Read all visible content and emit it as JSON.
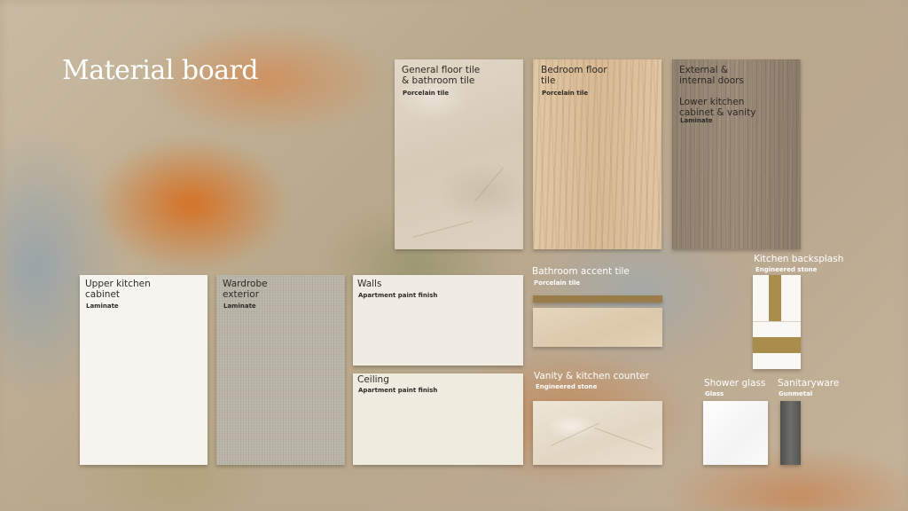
{
  "title": "Material board",
  "materials": {
    "general_floor": {
      "label": "General floor tile\n& bathroom tile",
      "sub": "Porcelain tile"
    },
    "bedroom_floor": {
      "label": "Bedroom floor\ntile",
      "sub": "Porcelain tile"
    },
    "doors": {
      "label": "External &\ninternal doors\n\nLower kitchen\ncabinet & vanity",
      "sub": "Laminate"
    },
    "upper_cabinet": {
      "label": "Upper kitchen\ncabinet",
      "sub": "Laminate"
    },
    "wardrobe": {
      "label": "Wardrobe\nexterior",
      "sub": "Laminate"
    },
    "walls": {
      "label": "Walls",
      "sub": "Apartment paint finish"
    },
    "ceiling": {
      "label": "Ceiling",
      "sub": "Apartment paint finish"
    },
    "bath_accent": {
      "label": "Bathroom accent tile",
      "sub": "Porcelain tile"
    },
    "vanity_counter": {
      "label": "Vanity & kitchen counter",
      "sub": "Engineered stone"
    },
    "backsplash": {
      "label": "Kitchen backsplash",
      "sub": "Engineered stone"
    },
    "shower_glass": {
      "label": "Shower glass",
      "sub": "Glass"
    },
    "sanitaryware": {
      "label": "Sanitaryware",
      "sub": "Gunmetal"
    }
  },
  "colors": {
    "white_laminate": "#f7f4f0",
    "paint": "#efeae1",
    "gold_strip": "#a98d4d",
    "gunmetal": "#5f5f5c"
  }
}
